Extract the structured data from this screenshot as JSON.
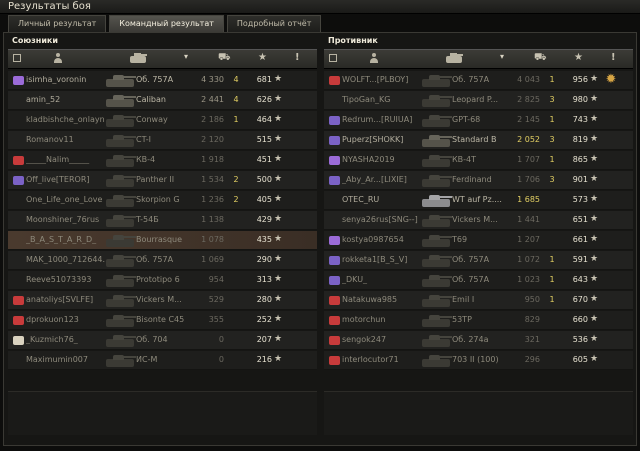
{
  "window": {
    "title": "Результаты боя"
  },
  "tabs": [
    {
      "label": "Личный результат",
      "active": false
    },
    {
      "label": "Командный результат",
      "active": true
    },
    {
      "label": "Подробный отчёт",
      "active": false
    }
  ],
  "icons": {
    "header": [
      "square-icon",
      "player-icon",
      "tank-icon",
      "chevron-down-icon",
      "destroyed-tank-icon",
      "star-icon",
      "exclamation-icon"
    ],
    "medal": "medal-icon"
  },
  "header_glyphs": {
    "chevron": "▾",
    "star": "★",
    "excl": "!",
    "medal": "✹",
    "tank_dead": "⛟"
  },
  "allies": {
    "title": "Союзники",
    "rows": [
      {
        "name": "isimha_voronin",
        "vehicle": "Об. 757А",
        "damage": "4 330",
        "kills": "4",
        "xp": "681",
        "badge": "#9b6bd8",
        "alive": true,
        "gold": false
      },
      {
        "name": "amin_52",
        "vehicle": "Caliban",
        "damage": "2 441",
        "kills": "4",
        "xp": "626",
        "badge": "",
        "alive": true,
        "gold": false
      },
      {
        "name": "kladbishche_onlayn",
        "vehicle": "Conway",
        "damage": "2 186",
        "kills": "1",
        "xp": "464",
        "badge": "",
        "alive": false,
        "gold": false
      },
      {
        "name": "Romanov11",
        "vehicle": "CT-I",
        "damage": "2 120",
        "kills": "",
        "xp": "515",
        "badge": "",
        "alive": false,
        "gold": false
      },
      {
        "name": "_____Nalim_____",
        "vehicle": "КВ-4",
        "damage": "1 918",
        "kills": "",
        "xp": "451",
        "badge": "#c83b3b",
        "alive": false,
        "gold": false
      },
      {
        "name": "Off_live[TEROR]",
        "vehicle": "Panther II",
        "damage": "1 534",
        "kills": "2",
        "xp": "500",
        "badge": "#7b62c6",
        "alive": false,
        "gold": false
      },
      {
        "name": "One_Life_one_Love",
        "vehicle": "Skorpion G",
        "damage": "1 236",
        "kills": "2",
        "xp": "405",
        "badge": "",
        "alive": false,
        "gold": false
      },
      {
        "name": "Moonshiner_76rus",
        "vehicle": "T-54Б",
        "damage": "1 138",
        "kills": "",
        "xp": "429",
        "badge": "",
        "alive": false,
        "gold": false
      },
      {
        "name": "_B_A_S_T_A_R_D_",
        "vehicle": "Bourrasque",
        "damage": "1 078",
        "kills": "",
        "xp": "435",
        "badge": "",
        "alive": false,
        "gold": false,
        "highlight": true
      },
      {
        "name": "MAK_1000_712644...",
        "vehicle": "Об. 757А",
        "damage": "1 069",
        "kills": "",
        "xp": "290",
        "badge": "",
        "alive": false,
        "gold": false
      },
      {
        "name": "Reeve51073393",
        "vehicle": "Prototipo 6",
        "damage": "954",
        "kills": "",
        "xp": "313",
        "badge": "",
        "alive": false,
        "gold": false
      },
      {
        "name": "anatoliys[SVLFE]",
        "vehicle": "Vickers M...",
        "damage": "529",
        "kills": "",
        "xp": "280",
        "badge": "#c83b3b",
        "alive": false,
        "gold": false
      },
      {
        "name": "dprokuon123",
        "vehicle": "Bisonte C45",
        "damage": "355",
        "kills": "",
        "xp": "252",
        "badge": "#c83b3b",
        "alive": false,
        "gold": false
      },
      {
        "name": "_Kuzmich76_",
        "vehicle": "Об. 704",
        "damage": "0",
        "kills": "",
        "xp": "207",
        "badge": "#d9d2bf",
        "alive": false,
        "gold": false
      },
      {
        "name": "Maximumin007",
        "vehicle": "ИС-М",
        "damage": "0",
        "kills": "",
        "xp": "216",
        "badge": "",
        "alive": false,
        "gold": false
      }
    ]
  },
  "enemies": {
    "title": "Противник",
    "rows": [
      {
        "name": "WOLFT...[PLBOY]",
        "vehicle": "Об. 757А",
        "damage": "4 043",
        "kills": "1",
        "xp": "956",
        "badge": "#c83b3b",
        "alive": false,
        "gold": false
      },
      {
        "name": "TipoGan_KG",
        "vehicle": "Leopard P...",
        "damage": "2 825",
        "kills": "3",
        "xp": "980",
        "badge": "",
        "alive": false,
        "gold": false
      },
      {
        "name": "Redrum...[RUIUA]",
        "vehicle": "GPT-68",
        "damage": "2 145",
        "kills": "1",
        "xp": "743",
        "badge": "#7b62c6",
        "alive": false,
        "gold": false
      },
      {
        "name": "Puperz[SHOKK]",
        "vehicle": "Standard B",
        "damage": "2 052",
        "kills": "3",
        "xp": "819",
        "badge": "#7b62c6",
        "alive": true,
        "gold": true
      },
      {
        "name": "NYASHA2019",
        "vehicle": "КВ-4Т",
        "damage": "1 707",
        "kills": "1",
        "xp": "865",
        "badge": "#9b6bd8",
        "alive": false,
        "gold": false
      },
      {
        "name": "_Aby_Ar...[LIXIE]",
        "vehicle": "Ferdinand",
        "damage": "1 706",
        "kills": "3",
        "xp": "901",
        "badge": "#7b62c6",
        "alive": false,
        "gold": false
      },
      {
        "name": "OTEC_RU",
        "vehicle": "WT auf Pz....",
        "damage": "1 685",
        "kills": "",
        "xp": "573",
        "badge": "",
        "alive": true,
        "gold": true,
        "plain": true
      },
      {
        "name": "senya26rus[SNG--]",
        "vehicle": "Vickers M...",
        "damage": "1 441",
        "kills": "",
        "xp": "651",
        "badge": "",
        "alive": false,
        "gold": false
      },
      {
        "name": "kostya0987654",
        "vehicle": "T69",
        "damage": "1 207",
        "kills": "",
        "xp": "661",
        "badge": "#9b6bd8",
        "alive": false,
        "gold": false
      },
      {
        "name": "rokketa1[B_S_V]",
        "vehicle": "Об. 757А",
        "damage": "1 072",
        "kills": "1",
        "xp": "591",
        "badge": "#7b62c6",
        "alive": false,
        "gold": false
      },
      {
        "name": "_DKU_",
        "vehicle": "Об. 757А",
        "damage": "1 023",
        "kills": "1",
        "xp": "643",
        "badge": "#7b62c6",
        "alive": false,
        "gold": false
      },
      {
        "name": "Natakuwa985",
        "vehicle": "Emil I",
        "damage": "950",
        "kills": "1",
        "xp": "670",
        "badge": "#c83b3b",
        "alive": false,
        "gold": false
      },
      {
        "name": "motorchun",
        "vehicle": "53TP",
        "damage": "829",
        "kills": "",
        "xp": "660",
        "badge": "#c83b3b",
        "alive": false,
        "gold": false
      },
      {
        "name": "sengok247",
        "vehicle": "Об. 274а",
        "damage": "321",
        "kills": "",
        "xp": "536",
        "badge": "#c83b3b",
        "alive": false,
        "gold": false
      },
      {
        "name": "interlocutor71",
        "vehicle": "703 II (100)",
        "damage": "296",
        "kills": "",
        "xp": "605",
        "badge": "#c83b3b",
        "alive": false,
        "gold": false
      }
    ]
  }
}
